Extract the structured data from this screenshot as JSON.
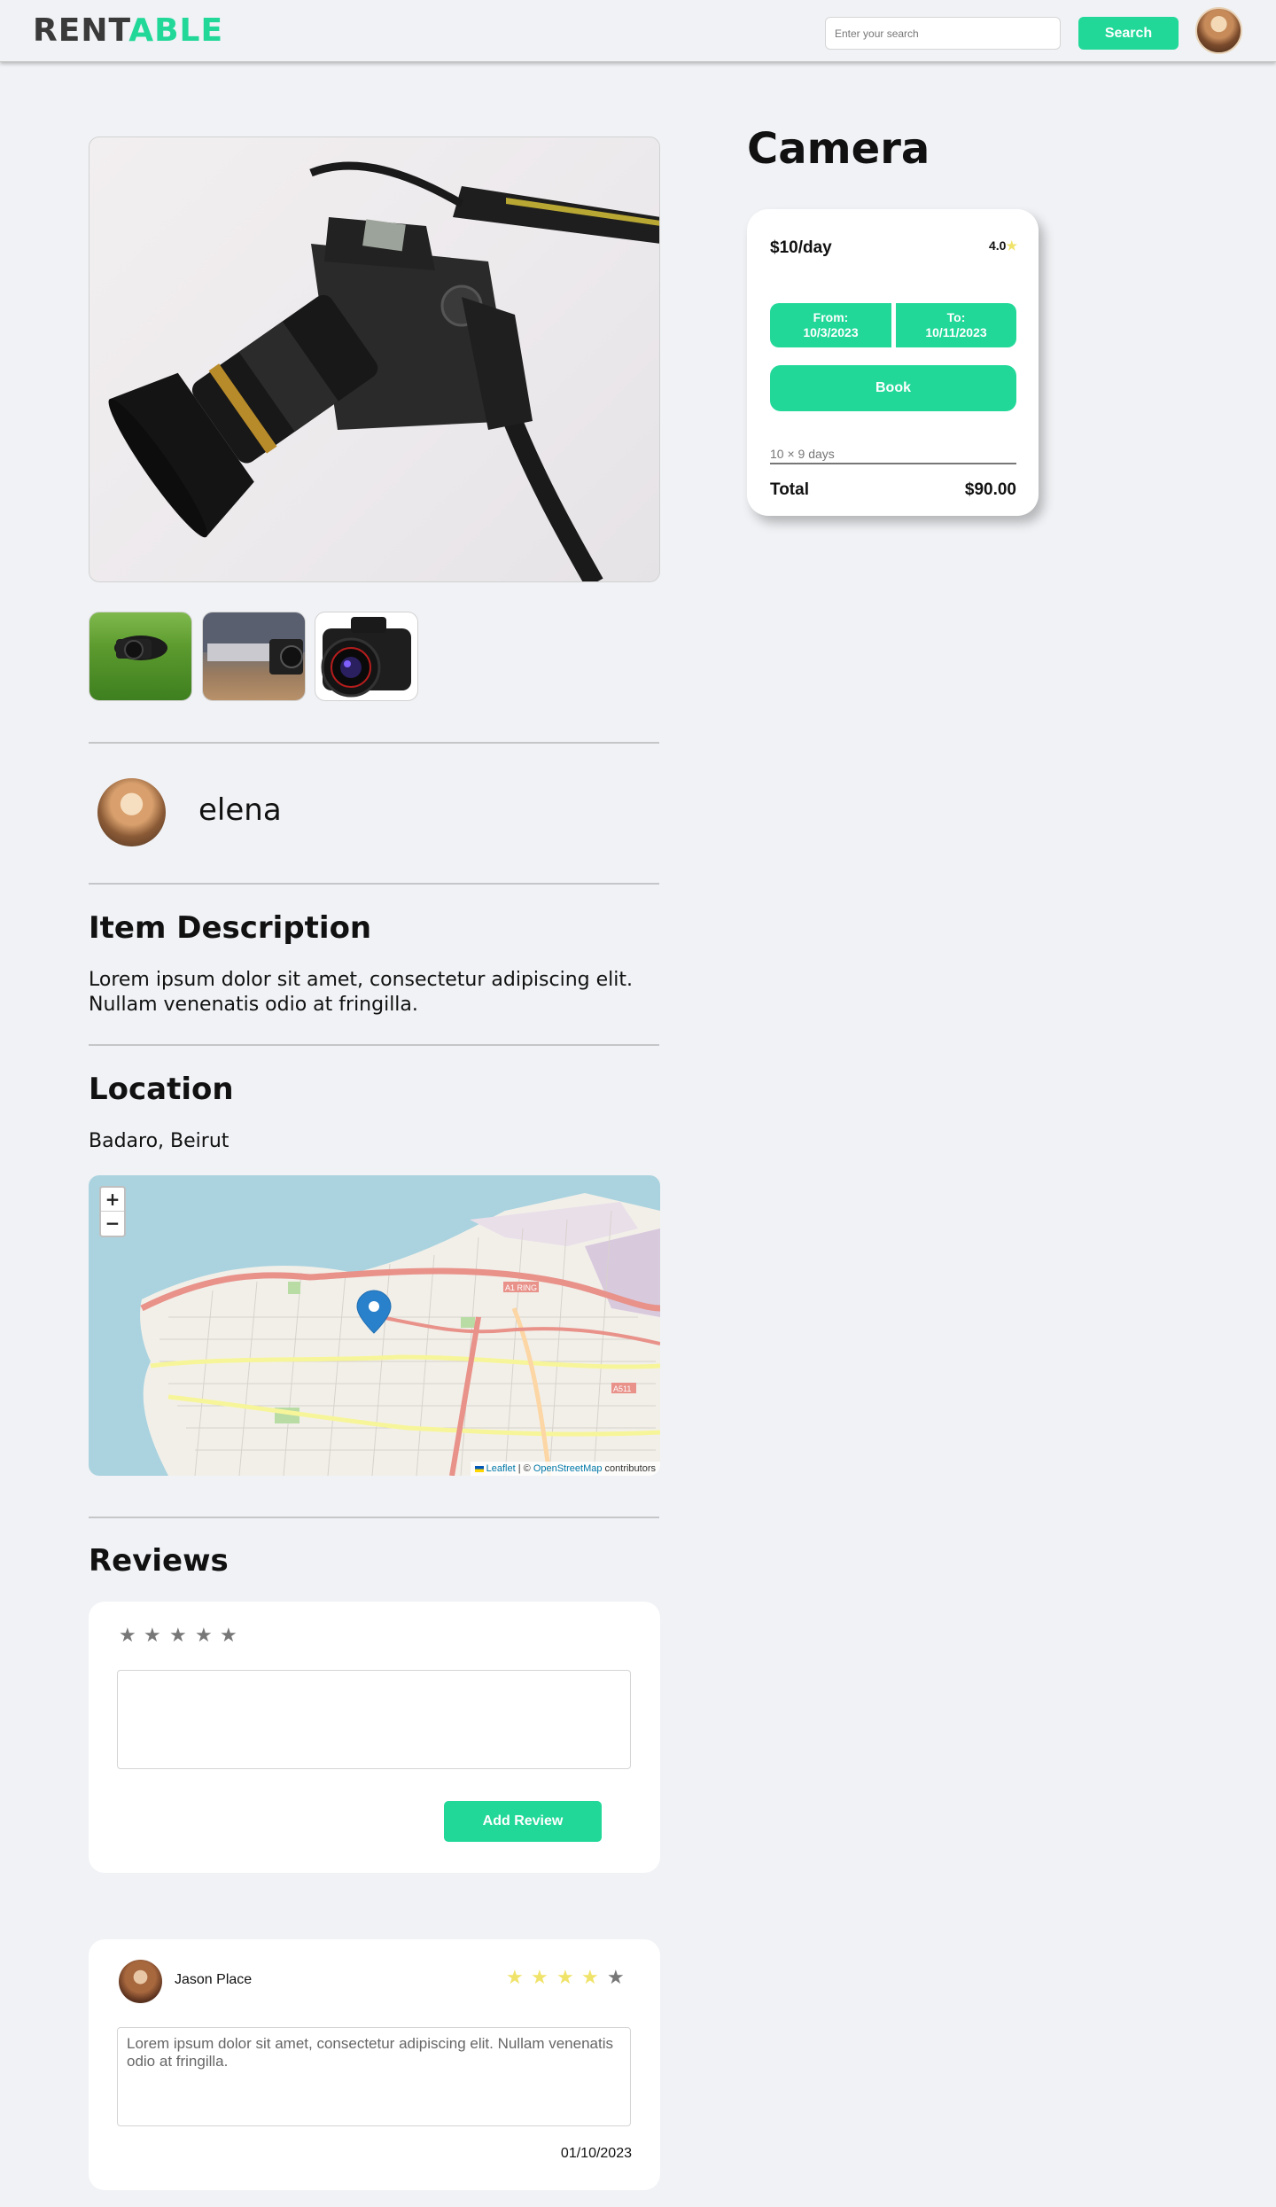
{
  "header": {
    "logo_part1": "RENT",
    "logo_part2": "ABLE",
    "search_placeholder": "Enter your search",
    "search_button": "Search",
    "accent_color": "#22d899"
  },
  "item": {
    "title": "Camera",
    "owner_name": "elena"
  },
  "booking": {
    "price": "$10/day",
    "rating": "4.0",
    "rating_star": "★",
    "from_label": "From:",
    "from_date": "10/3/2023",
    "to_label": "To:",
    "to_date": "10/11/2023",
    "book_button": "Book",
    "calculation": "10 × 9 days",
    "total_label": "Total",
    "total_value": "$90.00"
  },
  "description": {
    "heading": "Item Description",
    "text": "Lorem ipsum dolor sit amet, consectetur adipiscing elit. Nullam venenatis odio at fringilla."
  },
  "location": {
    "heading": "Location",
    "address": "Badaro, Beirut",
    "map": {
      "zoom_in": "+",
      "zoom_out": "−",
      "attribution_leaflet": "Leaflet",
      "attribution_separator": " | © ",
      "attribution_osm": "OpenStreetMap",
      "attribution_contributors": " contributors",
      "labels": [
        "A1 RING",
        "A511"
      ]
    }
  },
  "reviews": {
    "heading": "Reviews",
    "form": {
      "stars": [
        "★",
        "★",
        "★",
        "★",
        "★"
      ],
      "add_button": "Add Review"
    },
    "items": [
      {
        "name": "Jason Place",
        "rating": 4,
        "max_rating": 5,
        "stars": [
          "★",
          "★",
          "★",
          "★",
          "★"
        ],
        "text": "Lorem ipsum dolor sit amet, consectetur adipiscing elit. Nullam venenatis odio at fringilla.",
        "date": "01/10/2023"
      }
    ]
  }
}
